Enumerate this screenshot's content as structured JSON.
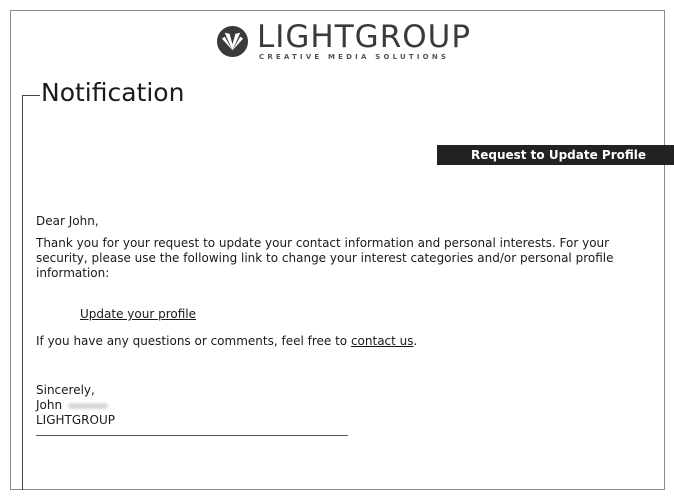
{
  "brand": {
    "name": "LIGHTGROUP",
    "tagline": "CREATIVE MEDIA SOLUTIONS",
    "logo_icon": "lightgroup-logo-icon"
  },
  "page": {
    "title": "Notification",
    "banner": "Request to Update Profile"
  },
  "message": {
    "greeting": "Dear John,",
    "paragraph": "Thank you for your request to update your contact information and personal interests. For your security, please use the following link to change your interest categories and/or personal profile information:",
    "update_link": "Update your profile",
    "questions_prefix": "If you have any questions or comments, feel free to ",
    "contact_link": "contact us",
    "questions_suffix": ".",
    "closing": "Sincerely,",
    "signer_first_name": "John",
    "signer_company": "LIGHTGROUP"
  },
  "colors": {
    "banner_bg": "#222222",
    "banner_text": "#ffffff",
    "frame_border": "#8c8c8c"
  }
}
